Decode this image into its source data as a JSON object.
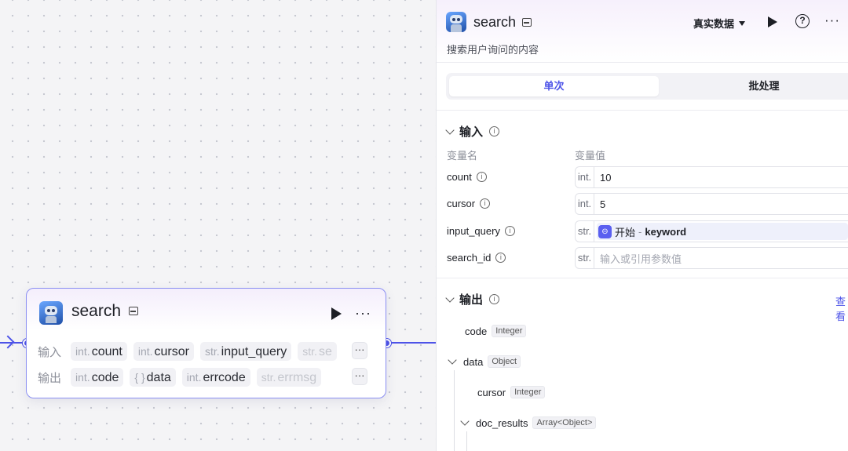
{
  "node": {
    "title": "search",
    "input_label": "输入",
    "output_label": "输出",
    "inputs": [
      {
        "type": "int.",
        "name": "count"
      },
      {
        "type": "int.",
        "name": "cursor"
      },
      {
        "type": "str.",
        "name": "input_query"
      },
      {
        "type": "str.",
        "name": "se"
      }
    ],
    "outputs": [
      {
        "type": "int.",
        "name": "code"
      },
      {
        "type": "{ }",
        "name": "data"
      },
      {
        "type": "int.",
        "name": "errcode"
      },
      {
        "type": "str.",
        "name": "errmsg"
      }
    ],
    "more": "···"
  },
  "panel": {
    "title": "search",
    "description": "搜索用户询问的内容",
    "data_mode": "真实数据",
    "help": "?",
    "more": "···",
    "tabs": [
      "单次",
      "批处理"
    ],
    "input_section": "输入",
    "col_name": "变量名",
    "col_value": "变量值",
    "variables": [
      {
        "name": "count",
        "type": "int.",
        "value": "10"
      },
      {
        "name": "cursor",
        "type": "int.",
        "value": "5"
      },
      {
        "name": "input_query",
        "type": "str.",
        "ref_source": "开始",
        "ref_sep": "-",
        "ref_key": "keyword"
      },
      {
        "name": "search_id",
        "type": "str.",
        "placeholder": "输入或引用参数值"
      }
    ],
    "output_section": "输出",
    "view_link": "查看",
    "outputs": [
      {
        "name": "code",
        "type": "Integer"
      },
      {
        "name": "data",
        "type": "Object"
      },
      {
        "name": "cursor",
        "type": "Integer"
      },
      {
        "name": "doc_results",
        "type": "Array<Object>"
      }
    ],
    "info_glyph": "i"
  }
}
